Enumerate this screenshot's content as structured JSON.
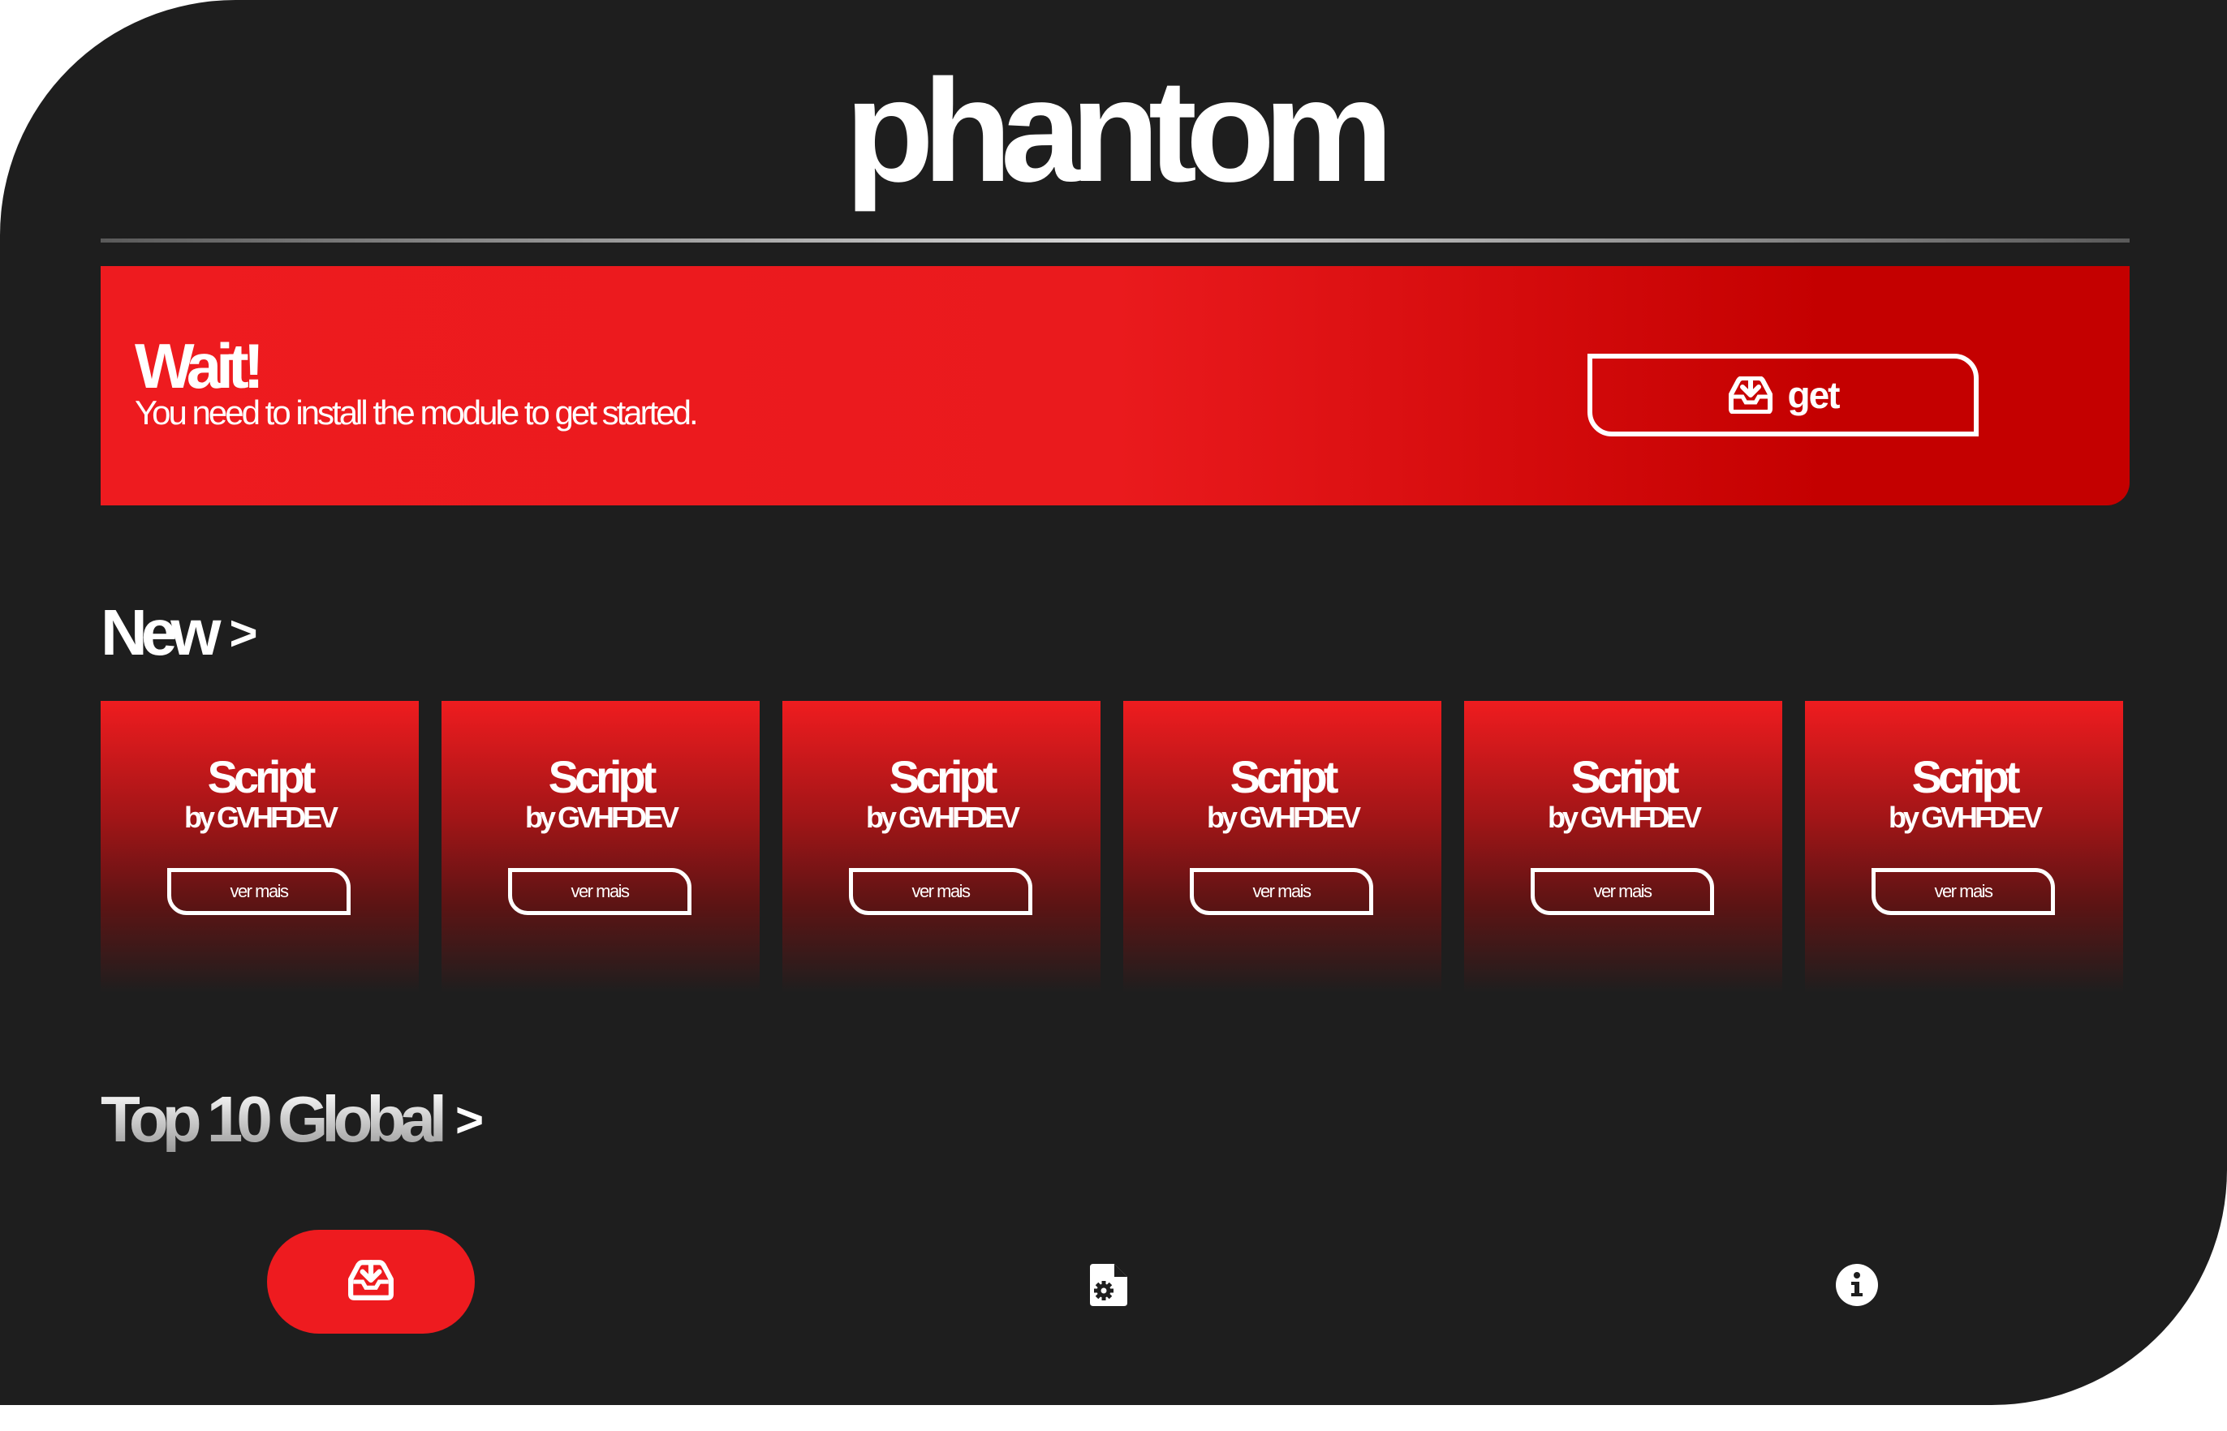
{
  "app": {
    "title": "phantom"
  },
  "banner": {
    "title": "Wait!",
    "message": "You need to install the module to get started.",
    "button_label": "get",
    "button_icon": "inbox-download-icon"
  },
  "sections": {
    "new": {
      "title": "New",
      "chevron": ">"
    },
    "top": {
      "title": "Top 10 Global",
      "chevron": ">"
    }
  },
  "cards": [
    {
      "title": "Script",
      "author": "by GVHFDEV",
      "button": "ver mais"
    },
    {
      "title": "Script",
      "author": "by GVHFDEV",
      "button": "ver mais"
    },
    {
      "title": "Script",
      "author": "by GVHFDEV",
      "button": "ver mais"
    },
    {
      "title": "Script",
      "author": "by GVHFDEV",
      "button": "ver mais"
    },
    {
      "title": "Script",
      "author": "by GVHFDEV",
      "button": "ver mais"
    },
    {
      "title": "Script",
      "author": "by GVHFDEV",
      "button": "ver mais"
    }
  ],
  "bottom_nav": {
    "active": "download",
    "items": [
      {
        "id": "download",
        "icon": "inbox-download-icon"
      },
      {
        "id": "scripts",
        "icon": "file-gear-icon"
      },
      {
        "id": "info",
        "icon": "info-circle-icon"
      }
    ]
  },
  "colors": {
    "background": "#1e1e1e",
    "accent": "#ee1b1f",
    "accent_dark": "#c40000",
    "text": "#ffffff"
  }
}
